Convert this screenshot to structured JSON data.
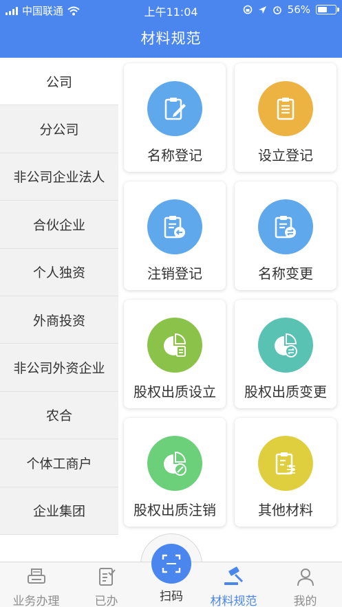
{
  "status_bar": {
    "carrier": "中国联通",
    "time": "上午11:04",
    "battery": "56%",
    "battery_level": 0.56
  },
  "header": {
    "title": "材料规范"
  },
  "sidebar": {
    "items": [
      {
        "label": "公司",
        "active": true
      },
      {
        "label": "分公司"
      },
      {
        "label": "非公司企业法人"
      },
      {
        "label": "合伙企业"
      },
      {
        "label": "个人独资"
      },
      {
        "label": "外商投资"
      },
      {
        "label": "非公司外资企业"
      },
      {
        "label": "农合"
      },
      {
        "label": "个体工商户"
      },
      {
        "label": "企业集团"
      }
    ]
  },
  "cards": [
    {
      "label": "名称登记",
      "icon": "clipboard-pen-icon",
      "color": "#5fa8ec"
    },
    {
      "label": "设立登记",
      "icon": "clipboard-list-icon",
      "color": "#ecb343"
    },
    {
      "label": "注销登记",
      "icon": "clipboard-back-icon",
      "color": "#5fa8ec"
    },
    {
      "label": "名称变更",
      "icon": "clipboard-swap-icon",
      "color": "#5fa8ec"
    },
    {
      "label": "股权出质设立",
      "icon": "pie-doc-icon",
      "color": "#8bc34a"
    },
    {
      "label": "股权出质变更",
      "icon": "pie-swap-icon",
      "color": "#5ac2b3"
    },
    {
      "label": "股权出质注销",
      "icon": "pie-cancel-icon",
      "color": "#6ccf7a"
    },
    {
      "label": "其他材料",
      "icon": "clipboard-sliders-icon",
      "color": "#dfcf3e"
    }
  ],
  "tabbar": {
    "tabs": [
      {
        "label": "业务办理",
        "icon": "printer-icon"
      },
      {
        "label": "已办",
        "icon": "checklist-icon"
      },
      {
        "label": "扫码",
        "icon": "scan-icon"
      },
      {
        "label": "材料规范",
        "icon": "gavel-icon",
        "active": true
      },
      {
        "label": "我的",
        "icon": "user-icon"
      }
    ]
  },
  "colors": {
    "brand": "#4a86ee",
    "sidebar_bg": "#f2f2f2",
    "text": "#333333",
    "tab_inactive": "#8e8e8e"
  }
}
